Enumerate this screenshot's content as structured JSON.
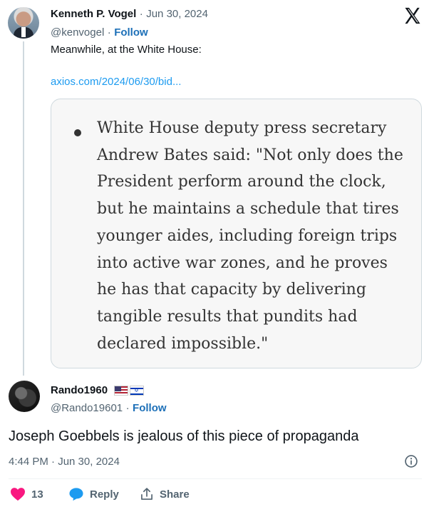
{
  "tweet": {
    "author_name": "Kenneth P. Vogel",
    "dot": "·",
    "date": "Jun 30, 2024",
    "handle": "@kenvogel",
    "follow_sep": "·",
    "follow": "Follow",
    "text": "Meanwhile, at the White House:",
    "link": "axios.com/2024/06/30/bid...",
    "quote": "White House deputy press secretary Andrew Bates said: \"Not only does the President perform around the clock, but he maintains a schedule that tires younger aides, including foreign trips into active war zones, and he proves he has that capacity by delivering tangible results that pundits had declared impossible.\""
  },
  "reply": {
    "author_name": "Rando1960",
    "flags": [
      "us-flag",
      "israel-flag"
    ],
    "handle": "@Rando19601",
    "follow_sep": "·",
    "follow": "Follow",
    "text": "Joseph Goebbels is jealous of this piece of propaganda",
    "timestamp": "4:44 PM · Jun 30, 2024"
  },
  "actions": {
    "like_count": "13",
    "reply_label": "Reply",
    "share_label": "Share"
  },
  "icons": {
    "brand": "x-logo-icon",
    "info": "info-icon",
    "like": "heart-icon",
    "reply": "reply-bubble-icon",
    "share": "share-icon"
  },
  "colors": {
    "heart": "#f91880",
    "reply_bubble": "#1d9bf0",
    "follow": "#1d70b8",
    "link": "#1d9bf0",
    "muted": "#536471"
  }
}
